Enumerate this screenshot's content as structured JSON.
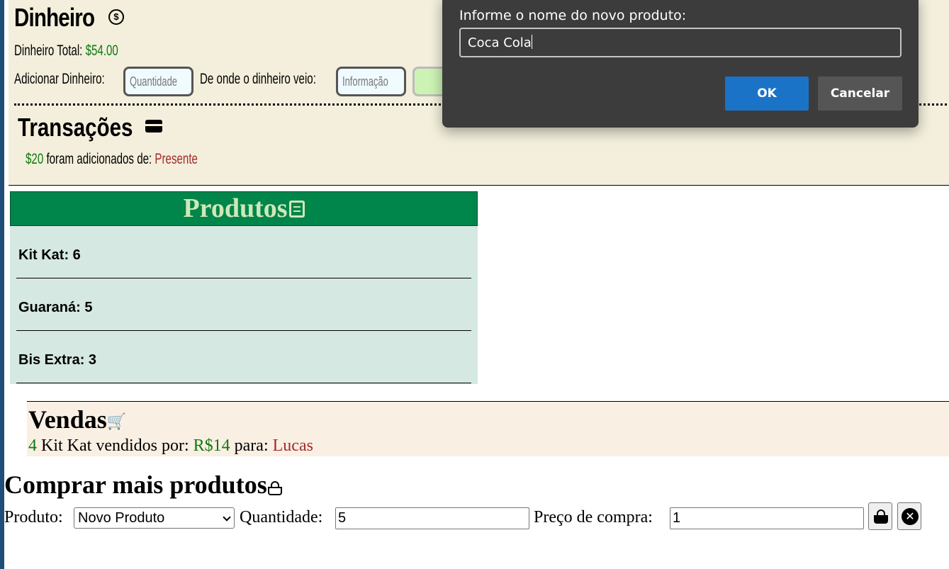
{
  "money": {
    "title": "Dinheiro",
    "total_label": "Dinheiro Total:",
    "total_value": "$54.00",
    "add_label": "Adicionar Dinheiro:",
    "quantity_placeholder": "Quantidade",
    "source_label": "De onde o dinheiro veio:",
    "info_placeholder": "Informação"
  },
  "transactions": {
    "title": "Transações",
    "items": [
      {
        "amount": "$20",
        "text": "foram adicionados de:",
        "source": "Presente"
      }
    ]
  },
  "products": {
    "title": "Produtos",
    "items": [
      {
        "label": "Kit Kat: 6"
      },
      {
        "label": "Guaraná: 5"
      },
      {
        "label": "Bis Extra: 3"
      }
    ]
  },
  "sales": {
    "title": "Vendas",
    "items": [
      {
        "quantity": "4",
        "product_text": "Kit Kat vendidos por:",
        "price": "R$14",
        "to_text": "para:",
        "buyer": "Lucas"
      }
    ]
  },
  "buy": {
    "title": "Comprar mais produtos",
    "product_label": "Produto:",
    "product_selected": "Novo Produto",
    "quantity_label": "Quantidade:",
    "quantity_value": "5",
    "price_label": "Preço de compra:",
    "price_value": "1"
  },
  "dialog": {
    "message": "Informe o nome do novo produto:",
    "input_value": "Coca Cola",
    "ok_label": "OK",
    "cancel_label": "Cancelar"
  },
  "colors": {
    "money_bg": "#f3efdc",
    "products_header": "#00854a",
    "products_bg": "#d5e8e1",
    "sales_bg": "#faefe3",
    "value_green": "#0f7a0f",
    "value_red": "#a52a2a",
    "dialog_bg": "#3c3c3c",
    "ok_blue": "#1a73c7"
  }
}
